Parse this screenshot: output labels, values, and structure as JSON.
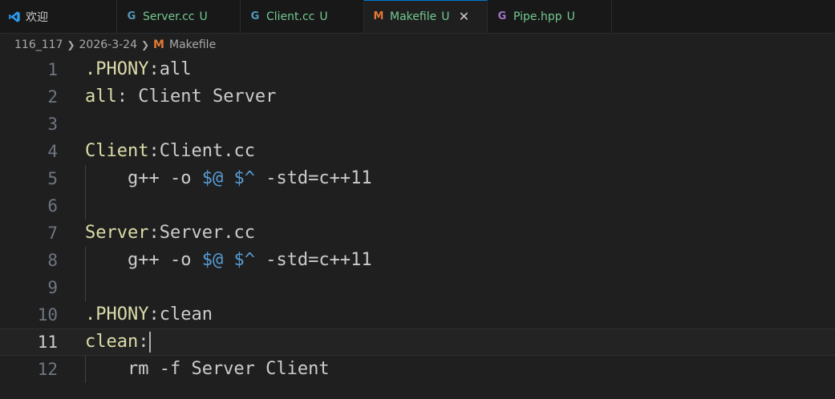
{
  "colors": {
    "accent": "#0078d4",
    "untracked": "#73c991",
    "cpp_icon": "#519aba",
    "hpp_icon": "#a074c4",
    "make_icon": "#e37933",
    "target": "#dcdcaa",
    "variable": "#569cd6"
  },
  "tabs": [
    {
      "label": "欢迎",
      "icon": "vscode-icon",
      "status": ""
    },
    {
      "label": "Server.cc",
      "icon": "cpp-file-icon",
      "status": "U"
    },
    {
      "label": "Client.cc",
      "icon": "cpp-file-icon",
      "status": "U"
    },
    {
      "label": "Makefile",
      "icon": "makefile-icon",
      "status": "U",
      "close": "✕"
    },
    {
      "label": "Pipe.hpp",
      "icon": "hpp-file-icon",
      "status": "U"
    }
  ],
  "breadcrumb": {
    "parts": [
      "116_117",
      "2026-3-24",
      "Makefile"
    ]
  },
  "editor": {
    "current_line": 11,
    "lines": [
      {
        "n": "1",
        "target": ".PHONY",
        "rest": ":all"
      },
      {
        "n": "2",
        "target": "all",
        "rest": ": Client Server"
      },
      {
        "n": "3"
      },
      {
        "n": "4",
        "target": "Client",
        "rest": ":Client.cc"
      },
      {
        "n": "5",
        "pre": "    g++ -o ",
        "v1": "$@",
        "mid": " ",
        "v2": "$^",
        "post": " -std=c++11"
      },
      {
        "n": "6"
      },
      {
        "n": "7",
        "target": "Server",
        "rest": ":Server.cc"
      },
      {
        "n": "8",
        "pre": "    g++ -o ",
        "v1": "$@",
        "mid": " ",
        "v2": "$^",
        "post": " -std=c++11"
      },
      {
        "n": "9"
      },
      {
        "n": "10",
        "target": ".PHONY",
        "rest": ":clean"
      },
      {
        "n": "11",
        "target": "clean",
        "rest": ":"
      },
      {
        "n": "12",
        "pre": "    rm -f Server Client"
      }
    ]
  }
}
